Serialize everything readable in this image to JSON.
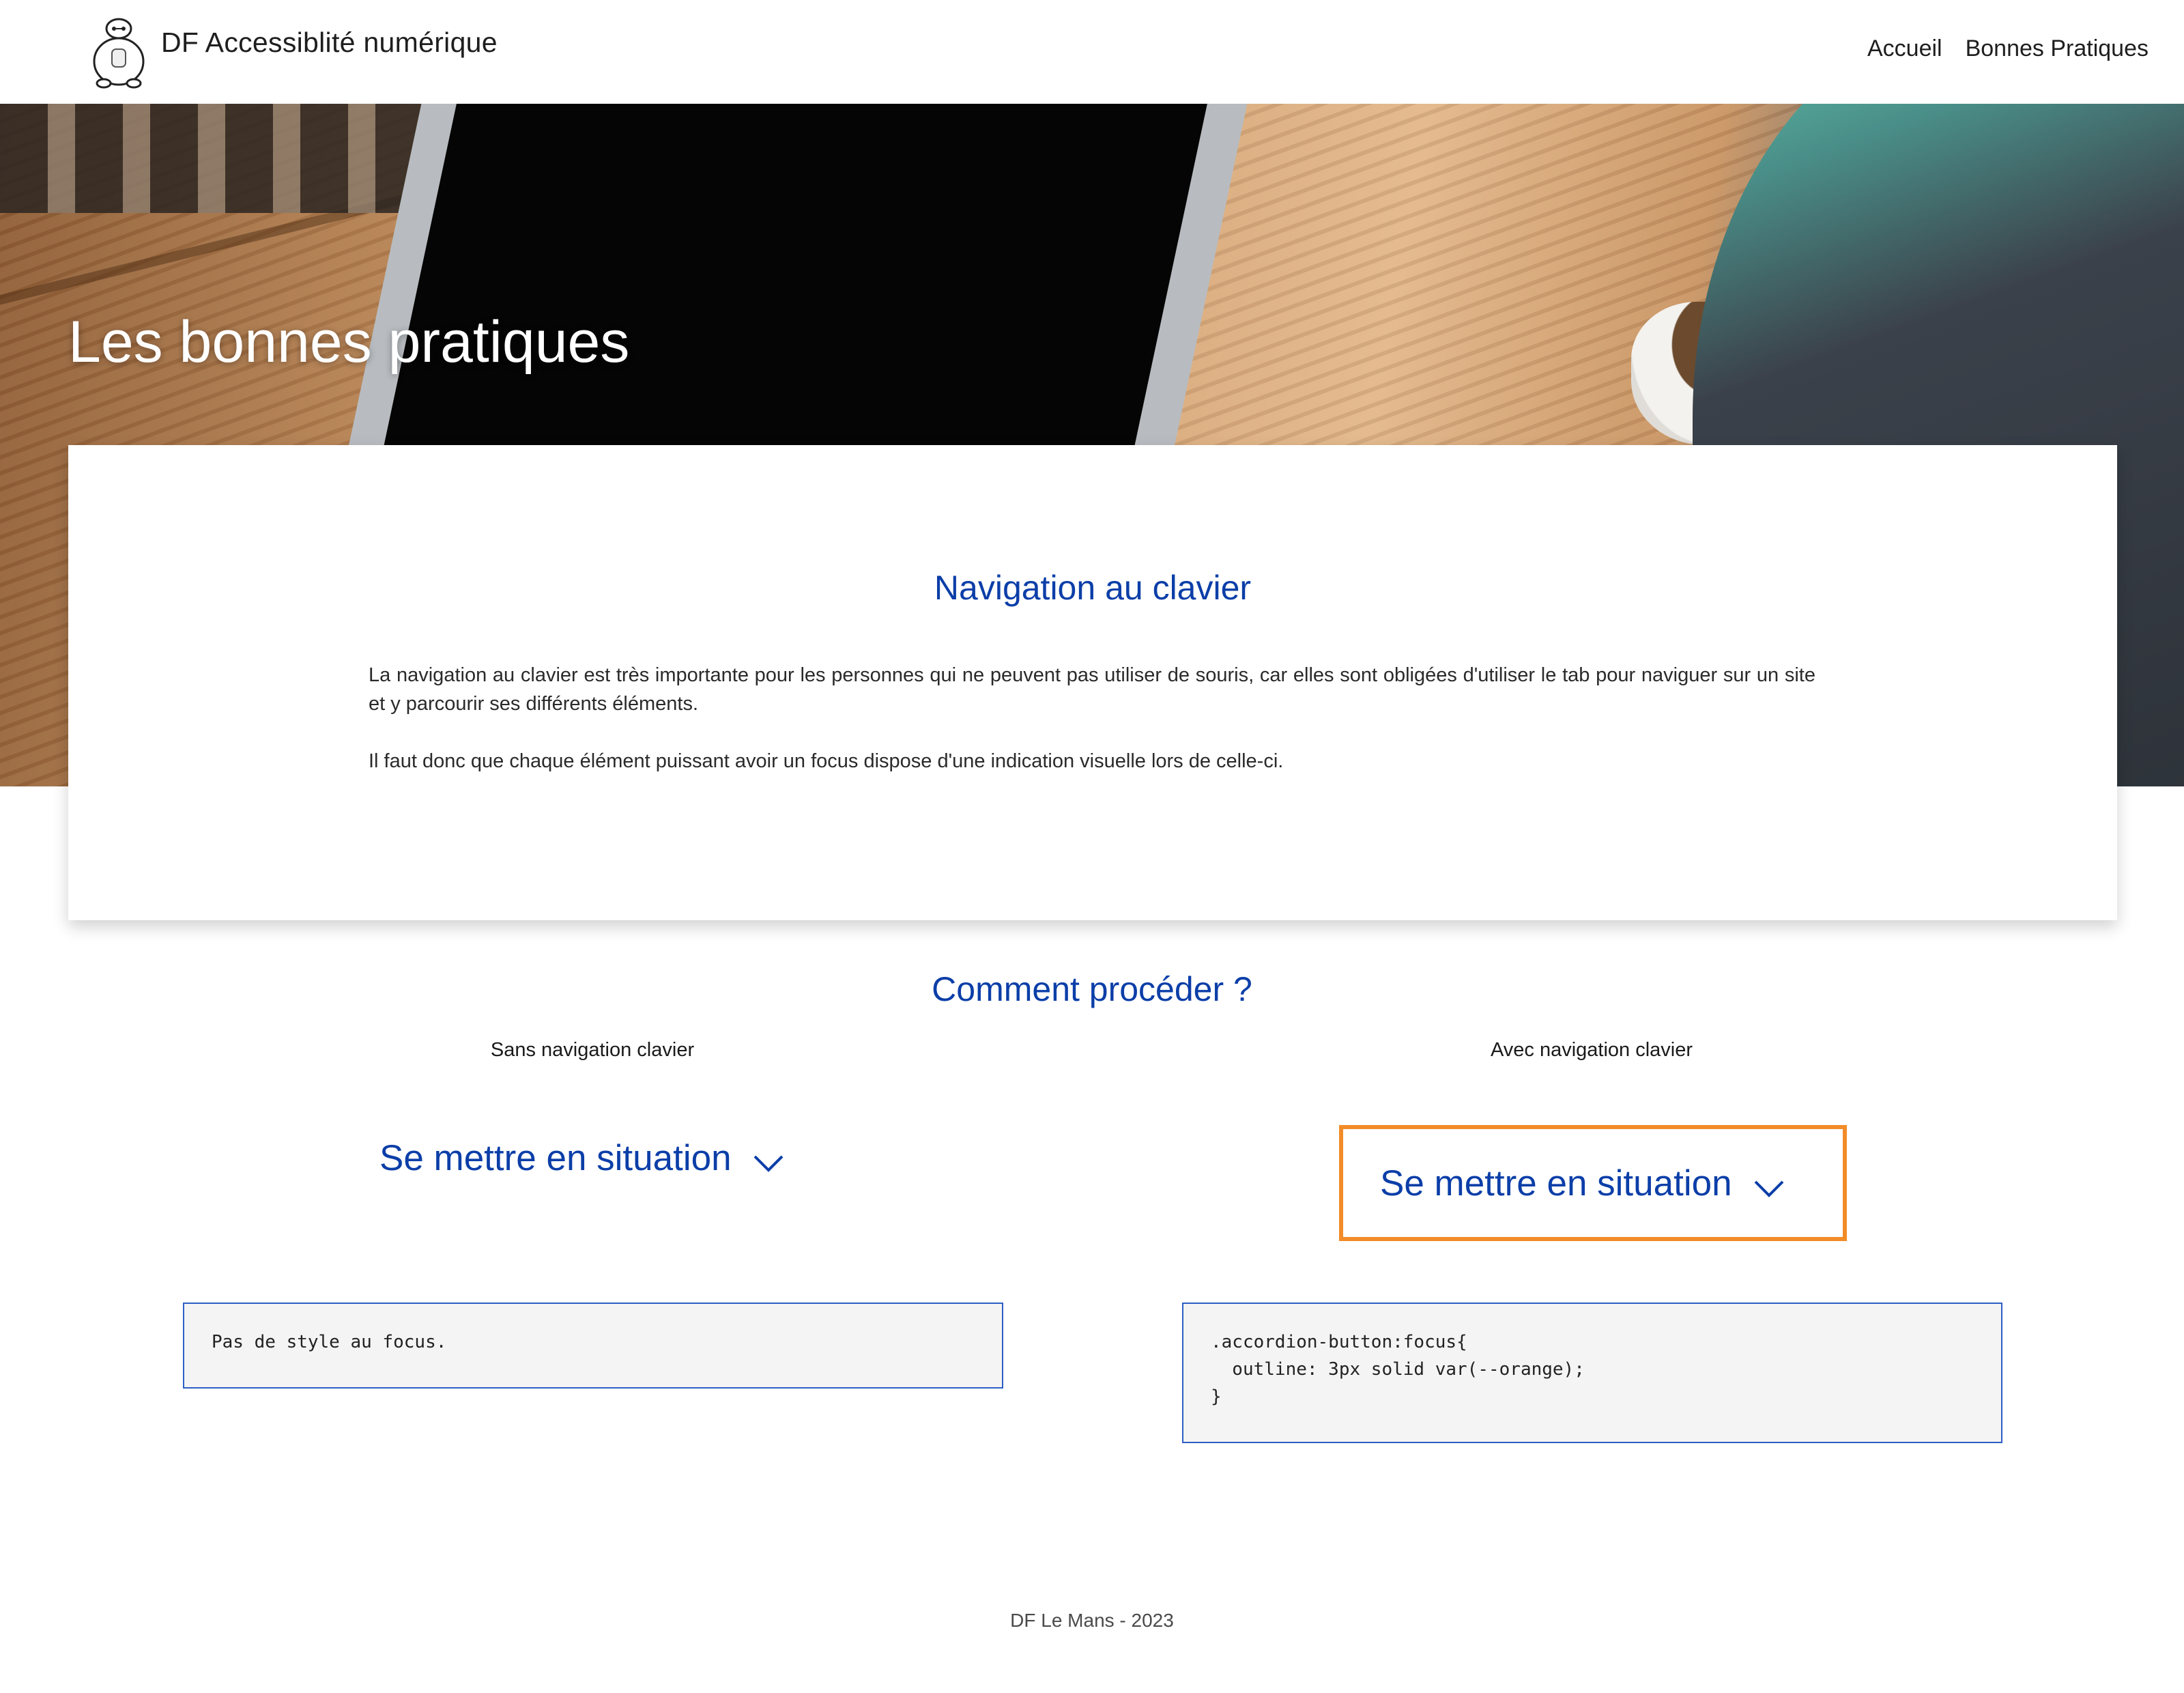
{
  "header": {
    "logo_icon": "robot-mascot-icon",
    "site_title": "DF Accessiblité numérique",
    "nav": [
      {
        "label": "Accueil"
      },
      {
        "label": "Bonnes Pratiques"
      }
    ]
  },
  "hero": {
    "title": "Les bonnes pratiques"
  },
  "intro": {
    "heading": "Navigation au clavier",
    "paragraph_1": "La navigation au clavier est très importante pour les personnes qui ne peuvent pas utiliser de souris, car elles sont obligées d'utiliser le tab pour naviguer sur un site et y parcourir ses différents éléments.",
    "paragraph_2": "Il faut donc que chaque élément puissant avoir un focus dispose d'une indication visuelle lors de celle-ci."
  },
  "howto": {
    "heading": "Comment procéder ?",
    "left": {
      "label": "Sans navigation clavier",
      "button_label": "Se mettre en situation",
      "chevron_icon": "chevron-down-icon",
      "code": "Pas de style au focus."
    },
    "right": {
      "label": "Avec navigation clavier",
      "button_label": "Se mettre en situation",
      "chevron_icon": "chevron-down-icon",
      "focus_outline_color": "#f28c28",
      "code": ".accordion-button:focus{\n  outline: 3px solid var(--orange);\n}"
    }
  },
  "footer": {
    "text": "DF Le Mans - 2023"
  },
  "colors": {
    "accent_blue": "#0b3ea8",
    "focus_orange": "#f28c28",
    "code_border": "#2d5fc4"
  }
}
